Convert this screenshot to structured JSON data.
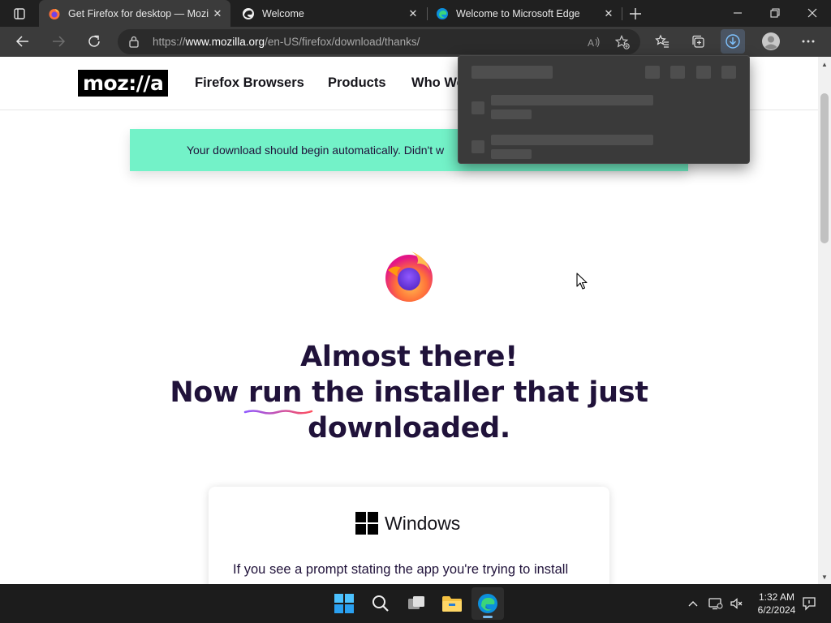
{
  "tabs": [
    {
      "title": "Get Firefox for desktop — Mozill",
      "icon": "firefox-icon",
      "active": true
    },
    {
      "title": "Welcome",
      "icon": "edge-dev-icon",
      "active": false
    },
    {
      "title": "Welcome to Microsoft Edge",
      "icon": "edge-icon",
      "active": false
    }
  ],
  "address": {
    "scheme": "https://",
    "host": "www.mozilla.org",
    "path": "/en-US/firefox/download/thanks/"
  },
  "site": {
    "logo_text": "moz://a",
    "nav": [
      "Firefox Browsers",
      "Products",
      "Who We"
    ],
    "notice": "Your download should begin automatically. Didn't w",
    "headline_line1": "Almost there!",
    "headline_now": "Now ",
    "headline_run": "run",
    "headline_rest": " the installer that just",
    "headline_line3": "downloaded.",
    "card_title": "Windows",
    "card_body": "If you see a prompt stating the app you're trying to install"
  },
  "taskbar": {
    "time": "1:32 AM",
    "date": "6/2/2024"
  },
  "colors": {
    "notice_bg": "#73f2c8",
    "headline": "#20123a",
    "download_button_bg": "#4b5563"
  }
}
